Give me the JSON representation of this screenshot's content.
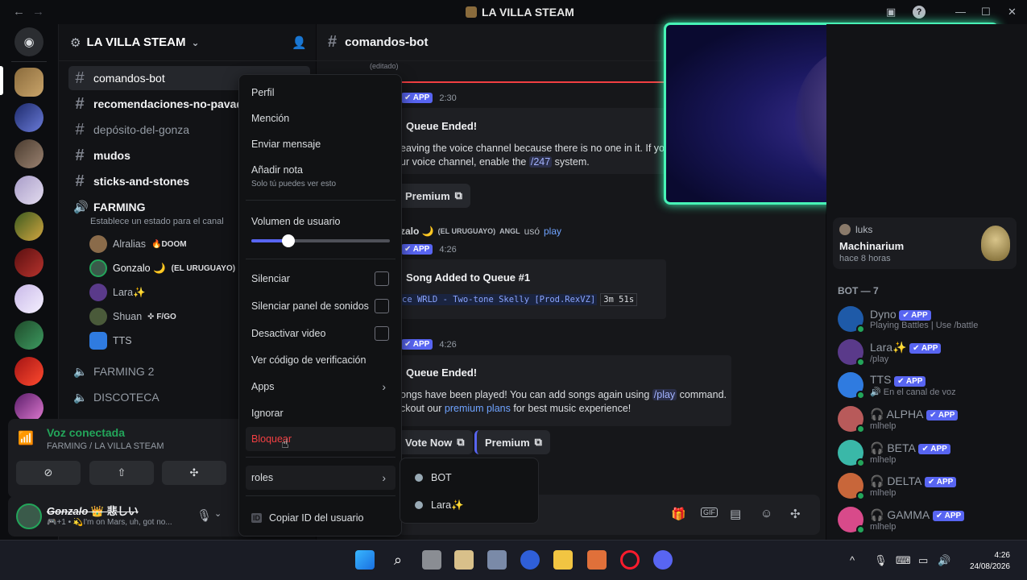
{
  "window": {
    "title": "LA VILLA STEAM"
  },
  "server": {
    "name": "LA VILLA STEAM"
  },
  "channels": [
    {
      "name": "comandos-bot"
    },
    {
      "name": "recomendaciones-no-pavadas"
    },
    {
      "name": "depósito-del-gonza"
    },
    {
      "name": "mudos"
    },
    {
      "name": "sticks-and-stones"
    }
  ],
  "voice_channel": {
    "name": "FARMING",
    "status_hint": "Establece un estado para el canal"
  },
  "voice_users": [
    {
      "name": "Alralias",
      "tag": "🔥DOOM"
    },
    {
      "name": "Gonzalo 🌙",
      "tag": "(EL URUGUAYO)"
    },
    {
      "name": "Lara✨",
      "tag": ""
    },
    {
      "name": "Shuan",
      "tag": "✜ F/GO"
    },
    {
      "name": "TTS",
      "tag": ""
    }
  ],
  "other_voice": [
    {
      "name": "FARMING 2"
    },
    {
      "name": "DISCOTECA"
    }
  ],
  "voice_connected": {
    "label": "Voz conectada",
    "location": "FARMING / LA VILLA STEAM"
  },
  "current_user": {
    "name": "Gonzalo",
    "extra": "👑 悲しい",
    "status": "🎮+1 • 💫I'm on Mars, uh, got no..."
  },
  "channel_header": {
    "name": "comandos-bot"
  },
  "chat": {
    "edited": "(editado)",
    "time1": "2:30",
    "embed1_title": "Queue Ended!",
    "embed1_line1": "eaving the voice channel because there is no one in it. If yo",
    "embed1_line2_a": "ur voice channel, enable the ",
    "embed1_cmd": "/247",
    "embed1_line2_b": " system.",
    "premium_btn": "Premium",
    "usage_user": "zalo 🌙",
    "usage_tag1": "(EL URUGUAYO)",
    "usage_tag2": "ANGL",
    "usage_word": "usó",
    "usage_cmd": "play",
    "time2": "4:26",
    "embed2_title": "Song Added to Queue #1",
    "embed2_track": "ce WRLD - Two-tone Skelly [Prod.RexVZ]",
    "embed2_duration": "3m 51s",
    "time3": "4:26",
    "embed3_title": "Queue Ended!",
    "embed3_line1_a": "ongs have been played! You can add songs again using ",
    "embed3_cmd": "/play",
    "embed3_line1_b": " command.",
    "embed3_line2_a": "ckout our ",
    "embed3_link": "premium plans",
    "embed3_line2_b": " for best music experience!",
    "vote_btn": "Vote Now",
    "premium_btn2": "Premium",
    "app_badge": "✔ APP"
  },
  "context_menu": {
    "items": [
      "Perfil",
      "Mención",
      "Enviar mensaje",
      "Añadir nota"
    ],
    "note_hint": "Solo tú puedes ver esto",
    "volume_label": "Volumen de usuario",
    "volume": 0.27,
    "mute": "Silenciar",
    "mute_sound": "Silenciar panel de sonidos",
    "disable_video": "Desactivar video",
    "verify": "Ver código de verificación",
    "apps": "Apps",
    "ignore": "Ignorar",
    "block": "Bloquear",
    "roles": "roles",
    "copy_id": "Copiar ID del usuario",
    "id_badge": "ID"
  },
  "roles_submenu": [
    "BOT",
    "Lara✨"
  ],
  "activity_card": {
    "user": "luks",
    "game": "Machinarium",
    "ago": "hace 8 horas"
  },
  "members": {
    "group_label": "BOT — 7",
    "list": [
      {
        "name": "Dyno",
        "sub": "Playing Battles | Use /battle"
      },
      {
        "name": "Lara✨",
        "sub": "/play"
      },
      {
        "name": "TTS",
        "sub": "🔊 En el canal de voz"
      },
      {
        "name": "🎧 ALPHA",
        "sub": "mlhelp"
      },
      {
        "name": "🎧 BETA",
        "sub": "mlhelp"
      },
      {
        "name": "🎧 DELTA",
        "sub": "mlhelp"
      },
      {
        "name": "🎧 GAMMA",
        "sub": "mlhelp"
      }
    ]
  },
  "taskbar": {
    "time": "4:26",
    "date": "24/08/2026"
  },
  "colors": {
    "accent": "#5865f2",
    "danger": "#f23f42",
    "online": "#23a55a",
    "cam_border": "#47f3b6"
  }
}
